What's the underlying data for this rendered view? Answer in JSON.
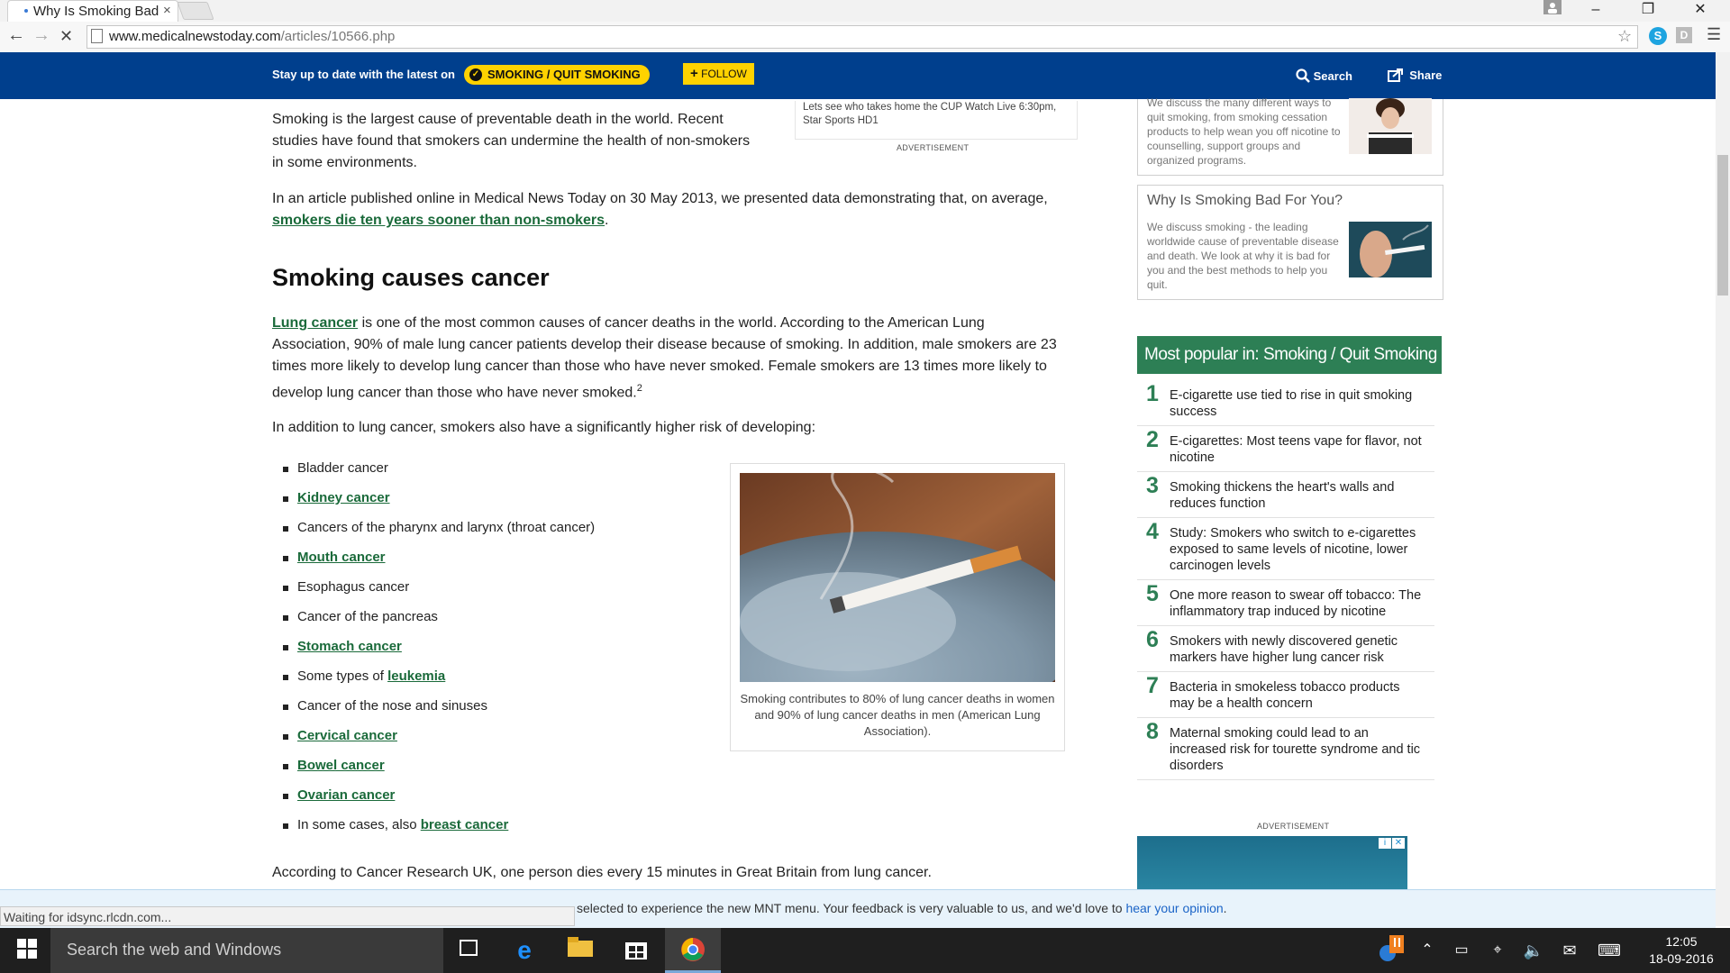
{
  "browser": {
    "tab_title": "Why Is Smoking Bad",
    "tab_close": "×",
    "url_host": "www.medicalnewstoday.com",
    "url_path": "/articles/10566.php",
    "status_text": "Waiting for idsync.rlcdn.com..."
  },
  "sitebar": {
    "stay_text": "Stay up to date with the latest on",
    "topic_label": "SMOKING / QUIT SMOKING",
    "follow_label": "FOLLOW",
    "search_label": "Search",
    "share_label": "Share"
  },
  "article": {
    "intro": "Smoking is the largest cause of preventable death in the world. Recent studies have found that smokers can undermine the health of non-smokers in some environments.",
    "p2_text": "In an article published online in Medical News Today on 30 May 2013, we presented data demonstrating that, on average,",
    "p2_link": "smokers die ten years sooner than non-smokers",
    "heading": "Smoking causes cancer",
    "p3_link": "Lung cancer",
    "p3_text": "is one of the most common causes of cancer deaths in the world. According to the American Lung Association, 90% of male lung cancer patients develop their disease because of smoking. In addition, male smokers are 23 times more likely to develop lung cancer than those who have never smoked. Female smokers are 13 times more likely to develop lung cancer than those who have never smoked.",
    "p3_sup": "2",
    "p4": "In addition to lung cancer, smokers also have a significantly higher risk of developing:",
    "list": [
      {
        "pre": "Bladder cancer",
        "link": "",
        "post": ""
      },
      {
        "pre": "",
        "link": "Kidney cancer",
        "post": ""
      },
      {
        "pre": "Cancers of the pharynx and larynx (throat cancer)",
        "link": "",
        "post": ""
      },
      {
        "pre": "",
        "link": "Mouth cancer",
        "post": ""
      },
      {
        "pre": "Esophagus cancer",
        "link": "",
        "post": ""
      },
      {
        "pre": "Cancer of the pancreas",
        "link": "",
        "post": ""
      },
      {
        "pre": "",
        "link": "Stomach cancer",
        "post": ""
      },
      {
        "pre": "Some types of ",
        "link": "leukemia",
        "post": ""
      },
      {
        "pre": "Cancer of the nose and sinuses",
        "link": "",
        "post": ""
      },
      {
        "pre": "",
        "link": "Cervical cancer",
        "post": ""
      },
      {
        "pre": "",
        "link": "Bowel cancer",
        "post": ""
      },
      {
        "pre": "",
        "link": "Ovarian cancer",
        "post": ""
      },
      {
        "pre": "In some cases, also ",
        "link": "breast cancer",
        "post": ""
      }
    ],
    "figure_caption": "Smoking contributes to 80% of lung cancer deaths in women and 90% of lung cancer deaths in men (American Lung Association).",
    "last_para": "According to Cancer Research UK, one person dies every 15 minutes in Great Britain from lung cancer.",
    "top_ad_text": "Lets see who takes home the CUP Watch Live 6:30pm, Star Sports HD1",
    "ad_label": "ADVERTISEMENT"
  },
  "sidebar": {
    "card1_desc": "We discuss the many different ways to quit smoking, from smoking cessation products to help wean you off nicotine to counselling, support groups and organized programs.",
    "card2_title": "Why Is Smoking Bad For You?",
    "card2_desc": "We discuss smoking - the leading worldwide cause of preventable disease and death. We look at why it is bad for you and the best methods to help you quit.",
    "most_popular_title": "Most popular in: Smoking / Quit Smoking",
    "popular": [
      {
        "num": "1",
        "text": "E-cigarette use tied to rise in quit smoking success"
      },
      {
        "num": "2",
        "text": "E-cigarettes: Most teens vape for flavor, not nicotine"
      },
      {
        "num": "3",
        "text": "Smoking thickens the heart's walls and reduces function"
      },
      {
        "num": "4",
        "text": "Study: Smokers who switch to e-cigarettes exposed to same levels of nicotine, lower carcinogen levels"
      },
      {
        "num": "5",
        "text": "One more reason to swear off tobacco: The inflammatory trap induced by nicotine"
      },
      {
        "num": "6",
        "text": "Smokers with newly discovered genetic markers have higher lung cancer risk"
      },
      {
        "num": "7",
        "text": "Bacteria in smokeless tobacco products may be a health concern"
      },
      {
        "num": "8",
        "text": "Maternal smoking could lead to an increased risk for tourette syndrome and tic disorders"
      }
    ],
    "ad_label": "ADVERTISEMENT"
  },
  "notification": {
    "text": "selected to experience the new MNT menu. Your feedback is very valuable to us, and we'd love to",
    "link": "hear your opinion",
    "end": "."
  },
  "taskbar": {
    "search_placeholder": "Search the web and Windows",
    "time": "12:05",
    "date": "18-09-2016"
  },
  "colors": {
    "site_blue": "#003f8d",
    "accent_yellow": "#ffd200",
    "link_green": "#1a6a3a",
    "popular_green": "#2d7f55"
  }
}
